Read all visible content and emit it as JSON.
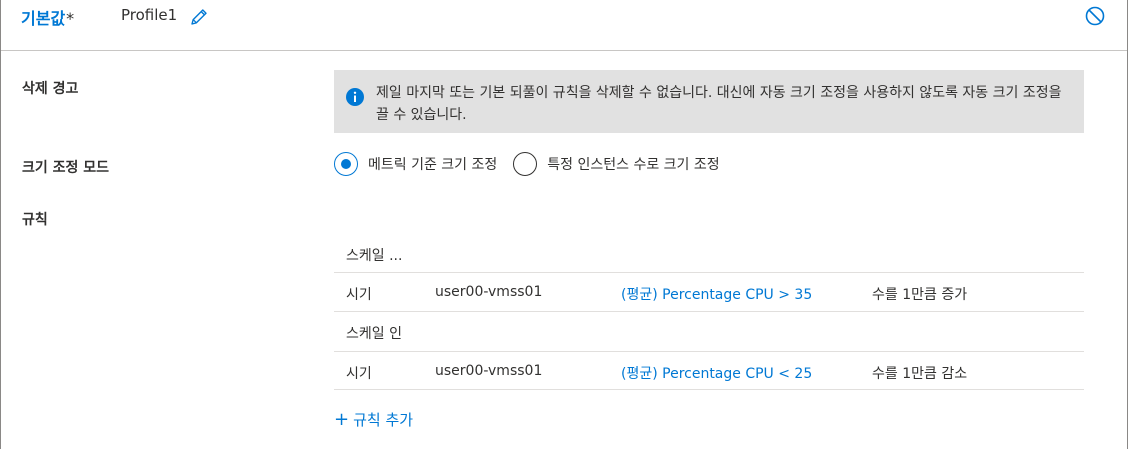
{
  "header": {
    "default_label": "기본값",
    "required_mark": "*",
    "profile_name": "Profile1",
    "edit_icon": "pencil-icon",
    "delete_icon": "circle-slash-icon"
  },
  "delete_warning": {
    "label": "삭제 경고",
    "icon": "info-icon",
    "message": "제일 마지막 또는 기본 되풀이 규칙을 삭제할 수 없습니다. 대신에 자동 크기 조정을 사용하지 않도록 자동 크기 조정을 끌 수 있습니다."
  },
  "scale_mode": {
    "label": "크기 조정 모드",
    "options": [
      {
        "label": "메트릭 기준 크기 조정",
        "selected": true
      },
      {
        "label": "특정 인스턴스 수로 크기 조정",
        "selected": false
      }
    ]
  },
  "rules": {
    "label": "규칙",
    "groups": [
      {
        "title": "스케일 ...",
        "rows": [
          {
            "when": "시기",
            "resource": "user00-vmss01",
            "metric": "(평균) Percentage CPU > 35",
            "action": "수를 1만큼 증가"
          }
        ]
      },
      {
        "title": "스케일 인",
        "rows": [
          {
            "when": "시기",
            "resource": "user00-vmss01",
            "metric": "(평균) Percentage CPU < 25",
            "action": "수를 1만큼 감소"
          }
        ]
      }
    ],
    "add_rule_label": "규칙 추가"
  },
  "colors": {
    "accent": "#0078d4",
    "text": "#323130",
    "info_bg": "#e1e1e1",
    "divider": "#e1dfdd"
  }
}
